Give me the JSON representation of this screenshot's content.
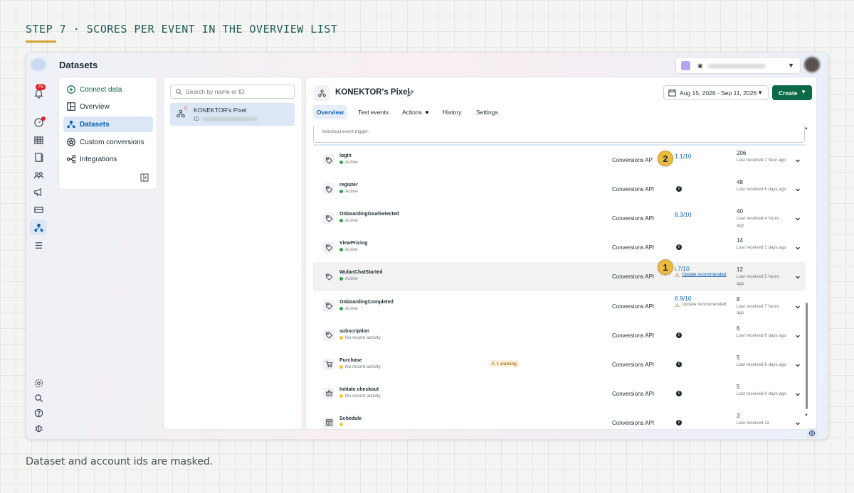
{
  "step_title": "STEP 7 · SCORES PER EVENT IN THE OVERVIEW LIST",
  "caption": "Dataset and account ids are masked.",
  "window": {
    "title": "Datasets",
    "notifications_count": "75"
  },
  "account": {
    "icon": "briefcase-icon"
  },
  "nav": {
    "connect": "Connect data",
    "items": [
      "Overview",
      "Datasets",
      "Custom conversions",
      "Integrations"
    ],
    "active": "Datasets"
  },
  "list": {
    "search_placeholder": "Search by name or ID",
    "pixel_name": "KONEKTOR's Pixel",
    "pixel_id_label": "ID"
  },
  "main": {
    "pixel_title": "KONEKTOR's Pixel",
    "date_range": "Aug 15, 2026 - Sep 11, 2026",
    "create_label": "Create",
    "tabs": [
      "Overview",
      "Test events",
      "Actions",
      "History",
      "Settings"
    ],
    "active_tab": "Overview",
    "top_note": "individual event trigger."
  },
  "events": [
    {
      "name": "login",
      "status": "Active",
      "status_color": "#31a24c",
      "source": "Conversions AP",
      "score": "1.1/10",
      "count": "206",
      "last": "Last received 1 hour ago"
    },
    {
      "name": "register",
      "status": "Active",
      "status_color": "#31a24c",
      "source": "Conversions API",
      "score": "",
      "count": "48",
      "last": "Last received 6 days ago"
    },
    {
      "name": "OnboardingGoalSelected",
      "status": "Active",
      "status_color": "#31a24c",
      "source": "Conversions API",
      "score": "8.3/10",
      "count": "40",
      "last": "Last received 4 hours ago"
    },
    {
      "name": "ViewPricing",
      "status": "Active",
      "status_color": "#31a24c",
      "source": "Conversions API",
      "score": "",
      "count": "14",
      "last": "Last received 2 days ago"
    },
    {
      "name": "WulanChatStarted",
      "status": "Active",
      "status_color": "#31a24c",
      "source": "Conversions API",
      "score": "i.7/10",
      "update": "Update recommended",
      "count": "12",
      "last": "Last received 5 hours ago"
    },
    {
      "name": "OnboardingCompleted",
      "status": "Active",
      "status_color": "#31a24c",
      "source": "Conversions API",
      "score": "6.9/10",
      "update": "Update recommended",
      "count": "8",
      "last": "Last received 7 hours ago"
    },
    {
      "name": "subscription",
      "status": "No recent activity",
      "status_color": "#f5c33b",
      "source": "Conversions API",
      "score": "",
      "count": "6",
      "last": "Last received 8 days ago"
    },
    {
      "name": "Purchase",
      "status": "No recent activity",
      "status_color": "#f5c33b",
      "source": "Conversions API",
      "score": "",
      "warning": "1 warning",
      "count": "5",
      "last": "Last received 8 days ago"
    },
    {
      "name": "Initiate checkout",
      "status": "No recent activity",
      "status_color": "#f5c33b",
      "source": "Conversions API",
      "score": "",
      "count": "5",
      "last": "Last received 8 days ago"
    },
    {
      "name": "Schedule",
      "status": "",
      "status_color": "#f5c33b",
      "source": "Conversions API",
      "score": "",
      "count": "3",
      "last": "Last received 12"
    }
  ],
  "markers": {
    "first": "1",
    "second": "2"
  },
  "colors": {
    "accent_green": "#0b6b47",
    "link_blue": "#0a5fb4",
    "marker": "#ecbb3e",
    "title_teal": "#1d5b54",
    "underline": "#d4a234"
  }
}
